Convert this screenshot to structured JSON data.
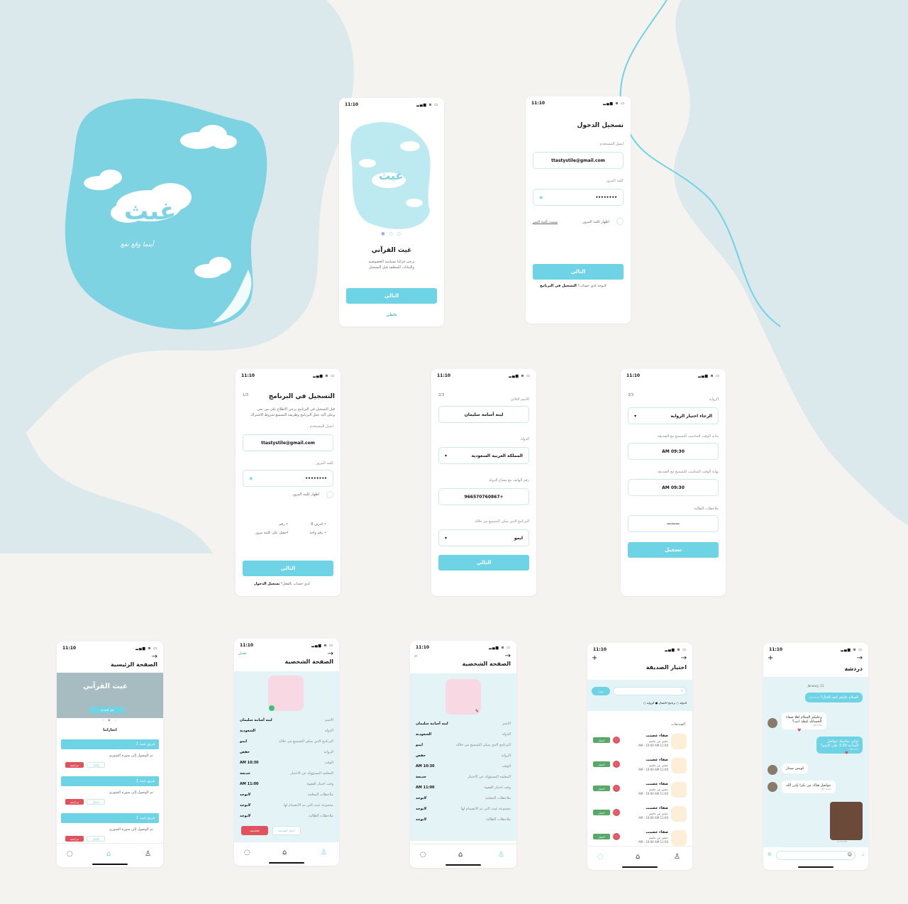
{
  "status": {
    "time": "11:10",
    "icons": "▂▄▆ ≋ ▭"
  },
  "cover": {
    "logo": "غيث",
    "logo_sub": "القرآني",
    "logo_top": "غيث",
    "tagline": "أينما وقع نفع"
  },
  "onboarding": {
    "logo": "غيث",
    "logo_sub": "القرآني",
    "title": "غيث القرآني",
    "desc1": "ترحب قرائنا بسياسة الخصوصية",
    "desc2": "والبيانات المتعلقة قبل التسجيل",
    "next": "التالي",
    "skip": "تخطي"
  },
  "login": {
    "title": "تسجيل الدخول",
    "email_label": "ايميل المستخدم",
    "email_value": "ttastystile@gmail.com",
    "password_label": "كلمة المرور",
    "password_value": "••••••••",
    "show_password": "اظهار كلمة المرور",
    "forgot": "نسيت كلمة السر",
    "next": "التالي",
    "no_account": "لايوجد لدي حساب؟",
    "register": "التسجيل في البرنامج"
  },
  "reg1": {
    "step": "1/3",
    "title": "التسجيل في البرنامج",
    "note1": "قبل التسجيل في البرنامج يرجى الاطلاع على من نحن",
    "note2": "وعلى آلية عمل البرنامج وطريقة التسميع شروط الاشتراك",
    "email_label": "ايميل المستخدم",
    "email_value": "ttastystile@gmail.com",
    "password_label": "كلمة المرور",
    "password_value": "••••••••",
    "show_password": "اظهار كلمة المرور",
    "rule1": "• احرف 8",
    "rule2": "• رقم",
    "rule3": "• رقم واحد",
    "rule4": "احصل على كلمة مرور",
    "next": "التالي",
    "have_account": "لدي حساب بالفعل؟",
    "login": "تسجيل الدخول"
  },
  "reg2": {
    "step": "2/3",
    "name_label": "الاسم الثلاثي",
    "name_value": "لينه أسامة سليمان",
    "country_label": "الدولة",
    "country_value": "المملكة العربية السعودية",
    "phone_label": "رقم الهاتف مع مفتاح الدولة",
    "phone_value": "+966570760867",
    "app_label": "البرنامج الذي يمكن التسميع من خلاله",
    "app_value": "ايمو",
    "next": "التالي"
  },
  "reg3": {
    "step": "3/3",
    "riwaya_label": "الرواية",
    "riwaya_value": "الرجاء اختيار الرواية",
    "start_label": "بداية الوقت المناسب للتسميع مع الصديقة",
    "start_value": "09:30 AM",
    "end_label": "نهاية الوقت المناسب للتسميع مع الصديقة",
    "end_value": "09:30 AM",
    "notes_label": "ملاحظات الطالبة",
    "notes_value": "———",
    "register": "تسجيل"
  },
  "home": {
    "title": "الصفحة الرئيسية",
    "banner_title": "غيث القرآني",
    "banner_btn": "قبل التعديل",
    "section": "انجازاتنا",
    "cards": [
      {
        "head": "فريق غيث 1",
        "text": "تم الوصول إلى سورة الشورى",
        "b1": "إكمال",
        "b2": "مراجعة"
      },
      {
        "head": "فريق غيث 1",
        "text": "تم الوصول إلى سورة الشورى",
        "b1": "إكمال",
        "b2": "مراجعة"
      },
      {
        "head": "فريق غيث 1",
        "text": "تم الوصول إلى سورة الشورى",
        "b1": "إكمال",
        "b2": "مراجعة"
      }
    ]
  },
  "profile": {
    "title": "الصفحة الشخصية",
    "edit": "تعديل",
    "done": "تم",
    "rows": [
      {
        "k": "الاسم",
        "v": "لينه أسامة سليمان"
      },
      {
        "k": "الدولة",
        "v": "السعودية"
      },
      {
        "k": "البرنامج الذي يمكن التسميع من خلاله",
        "v": "ايمو"
      },
      {
        "k": "الرواية",
        "v": "حفص"
      },
      {
        "k": "الوقت",
        "v": "10:30 AM"
      },
      {
        "k": "المعلمة المسؤولة عن الاختبار",
        "v": "خديجة"
      },
      {
        "k": "وقت اختبار القفوة",
        "v": "11:00 AM"
      },
      {
        "k": "ملاحظات المعلمة",
        "v": "لايوجد"
      },
      {
        "k": "مجموعة غيث التي تم الانضمام لها",
        "v": "لايوجد"
      },
      {
        "k": "ملاحظات الطالبة",
        "v": "لايوجد"
      }
    ],
    "update_btn": "تحديث",
    "choose_friend_btn": "اختيار الصديقة"
  },
  "friends": {
    "title": "اختيار الصديقة",
    "search_btn": "بحث",
    "filter1": "الدولة",
    "filter2": "برنامج الاتصال",
    "filter3": "الرواية",
    "section": "الصديقات",
    "items": [
      {
        "name": "صفاء عصمت",
        "sub": "حفص عن عاصم",
        "time": "11:00 AM - 10:00 AM",
        "btn": "اختيار"
      },
      {
        "name": "صفاء عصمت",
        "sub": "حفص عن عاصم",
        "time": "11:00 AM - 10:00 AM",
        "btn": "اختيار"
      },
      {
        "name": "صفاء عصمت",
        "sub": "حفص عن عاصم",
        "time": "11:00 AM - 10:00 AM",
        "btn": "اختيار"
      },
      {
        "name": "صفاء عصمت",
        "sub": "حفص عن عاصم",
        "time": "11:00 AM - 10:00 AM",
        "btn": "اختيار"
      },
      {
        "name": "صفاء عصمت",
        "sub": "حفص عن عاصم",
        "time": "11:00 AM - 10:00 AM",
        "btn": "اختيار"
      }
    ]
  },
  "chat": {
    "title": "دردشة",
    "date": "January, 21",
    "m1": "السلام عليكم كيف الحال؟",
    "m1_time": "12:30 AM",
    "m2": "وعليكم السلام اهلا صفاء",
    "m2b": "الحمدلله كيفك انت؟",
    "m2_time": "9:50 AM",
    "m3": "اوكي بنتاسبك نتواصل",
    "m3b": "الساعة 3:30 على الايمو؟",
    "m3_time": "9:55 AM",
    "m4": "كويس ممتاز",
    "m5": "نتواصل هناك من بكرا بإذن الله",
    "m5_time": "11:00 AM",
    "img_time": "12:13 AM"
  },
  "colors": {
    "accent": "#6fd3e6",
    "bgblob": "#dbe9ec",
    "red": "#e0525d",
    "green": "#5aa76a"
  }
}
